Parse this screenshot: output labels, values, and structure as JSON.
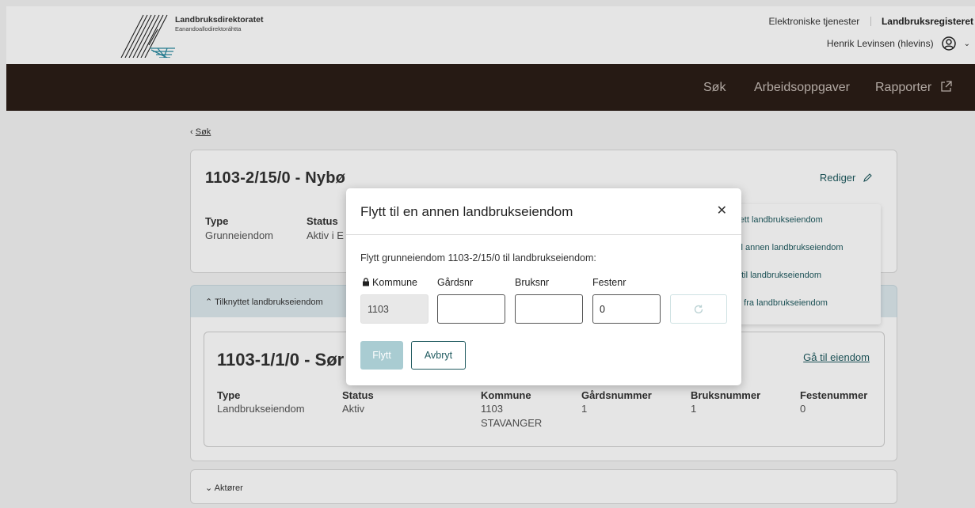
{
  "header": {
    "logo_title": "Landbruksdirektoratet",
    "logo_subtitle": "Eanandoallodirektoráhtta",
    "link_services": "Elektroniske tjenester",
    "link_register": "Landbruksregisteret",
    "user": "Henrik Levinsen (hlevins)"
  },
  "nav": {
    "search": "Søk",
    "tasks": "Arbeidsoppgaver",
    "reports": "Rapporter"
  },
  "breadcrumb": {
    "back": "Søk"
  },
  "property": {
    "title": "1103-2/15/0 - Nybø",
    "edit": "Rediger",
    "type_label": "Type",
    "type_value": "Grunneiendom",
    "status_label": "Status",
    "status_value": "Aktiv i E"
  },
  "actions_menu": [
    "rett landbrukseiendom",
    "til annen landbrukseiendom",
    "t til landbrukseiendom",
    "n fra landbrukseiendom"
  ],
  "linked_section": {
    "header": "Tilknyttet landbrukseiendom",
    "title": "1103-1/1/0 - Sør",
    "goto": "Gå til eiendom",
    "labels": [
      "Type",
      "Status",
      "Kommune",
      "Gårdsnummer",
      "Bruksnummer",
      "Festenummer"
    ],
    "values": [
      "Landbrukseiendom",
      "Aktiv",
      "1103",
      "1",
      "1",
      "0"
    ],
    "municipality_name": "STAVANGER"
  },
  "actors_section": {
    "header": "Aktører"
  },
  "modal": {
    "title": "Flytt til en annen landbrukseiendom",
    "description": "Flytt grunneiendom 1103-2/15/0 til landbrukseiendom:",
    "label_municipality": "Kommune",
    "label_farm": "Gårdsnr",
    "label_use": "Bruksnr",
    "label_lease": "Festenr",
    "value_municipality": "1103",
    "value_farm": "",
    "value_use": "",
    "value_lease": "0",
    "btn_move": "Flytt",
    "btn_cancel": "Avbryt"
  },
  "colors": {
    "nav_bg": "#2b1d17",
    "accent": "#1f5a5f",
    "section_head_bg": "#dde9ee",
    "disabled_button": "#a9ccd2"
  }
}
